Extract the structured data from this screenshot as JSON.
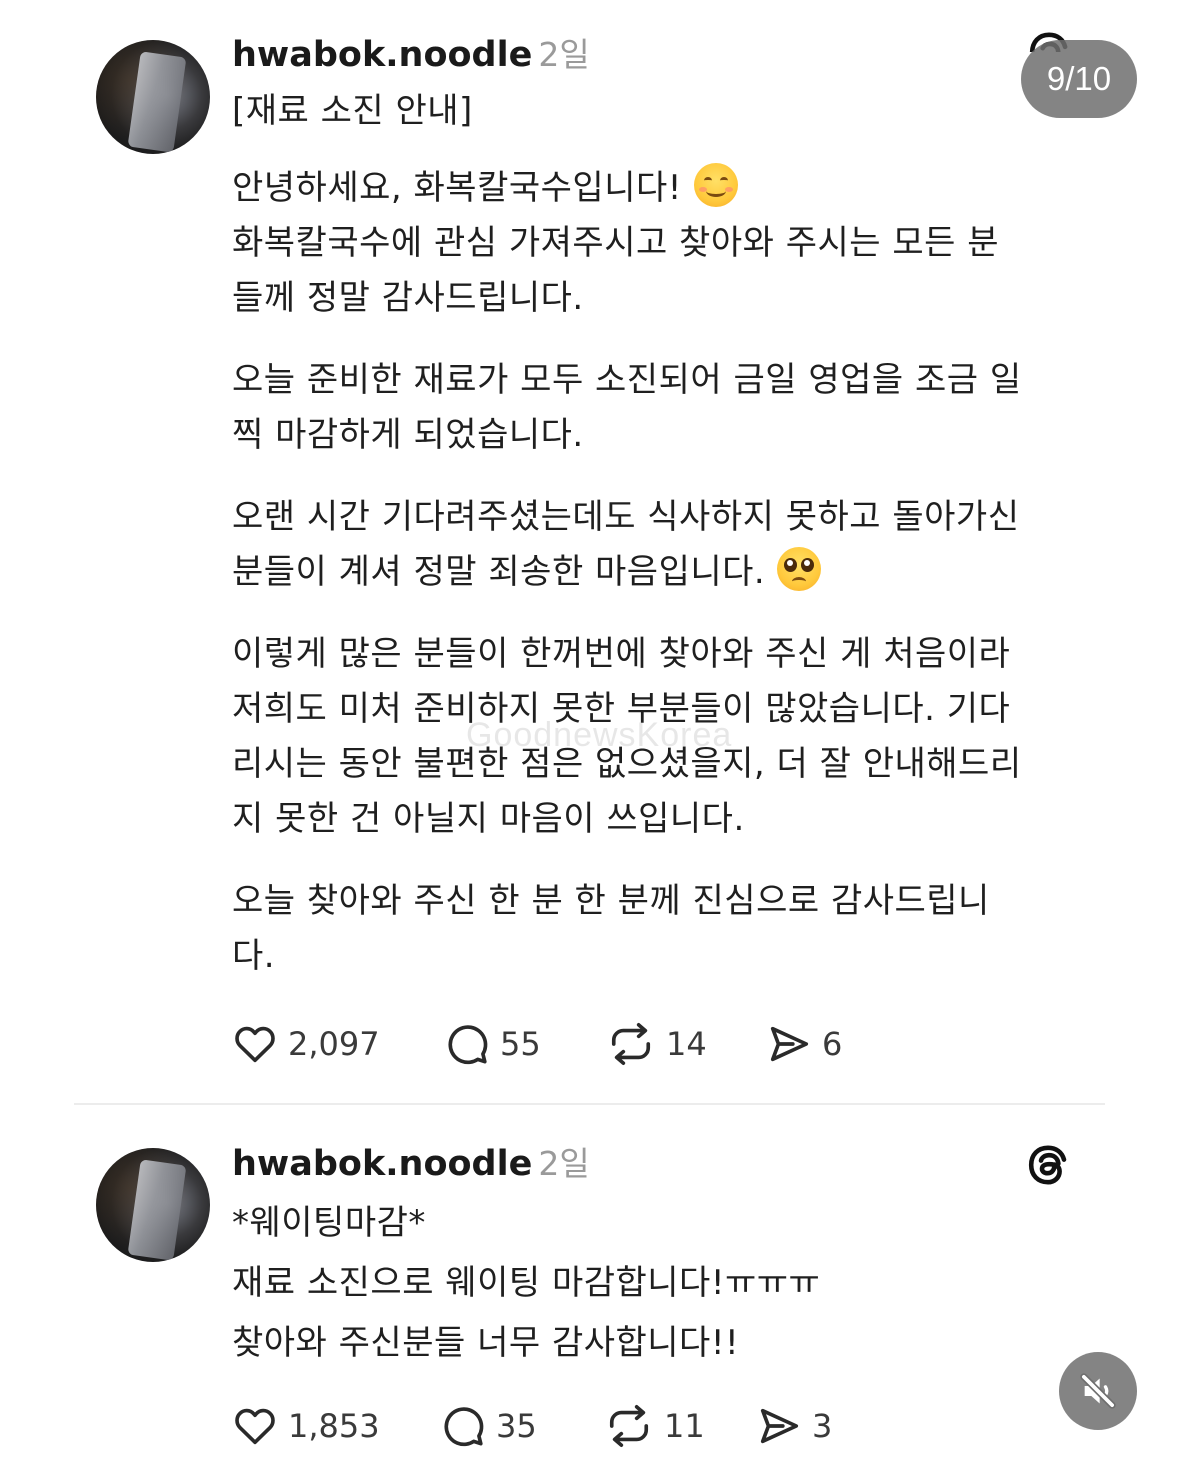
{
  "counter": "9/10",
  "watermark": "GoodnewsKorea",
  "posts": [
    {
      "username": "hwabok.noodle",
      "time": "2일",
      "title": "[재료 소진 안내]",
      "p1_line1": "안녕하세요, 화복칼국수입니다!",
      "p1_emoji": "smiling-face-emoji",
      "p1_line2": "화복칼국수에 관심 가져주시고 찾아와 주시는 모든 분",
      "p1_line3": "들께 정말 감사드립니다.",
      "p2_line1": "오늘 준비한 재료가 모두 소진되어 금일 영업을 조금 일",
      "p2_line2": "찍 마감하게 되었습니다.",
      "p3_line1": "오랜 시간 기다려주셨는데도 식사하지 못하고 돌아가신",
      "p3_line2": "분들이 계셔 정말 죄송한 마음입니다.",
      "p3_emoji": "pleading-face-emoji",
      "p4_line1": "이렇게 많은 분들이 한꺼번에 찾아와 주신 게 처음이라",
      "p4_line2": "저희도 미처 준비하지 못한 부분들이 많았습니다. 기다",
      "p4_line3": "리시는 동안 불편한 점은 없으셨을지, 더 잘 안내해드리",
      "p4_line4": "지 못한 건 아닐지 마음이 쓰입니다.",
      "p5_line1": "오늘 찾아와 주신 한 분 한 분께 진심으로 감사드립니",
      "p5_line2": "다.",
      "likes": "2,097",
      "comments": "55",
      "reposts": "14",
      "shares": "6"
    },
    {
      "username": "hwabok.noodle",
      "time": "2일",
      "line1": "*웨이팅마감*",
      "line2": "재료 소진으로 웨이팅 마감합니다!ㅠㅠㅠ",
      "line3": "찾아와 주신분들 너무 감사합니다!!",
      "likes": "1,853",
      "comments": "35",
      "reposts": "11",
      "shares": "3"
    }
  ]
}
